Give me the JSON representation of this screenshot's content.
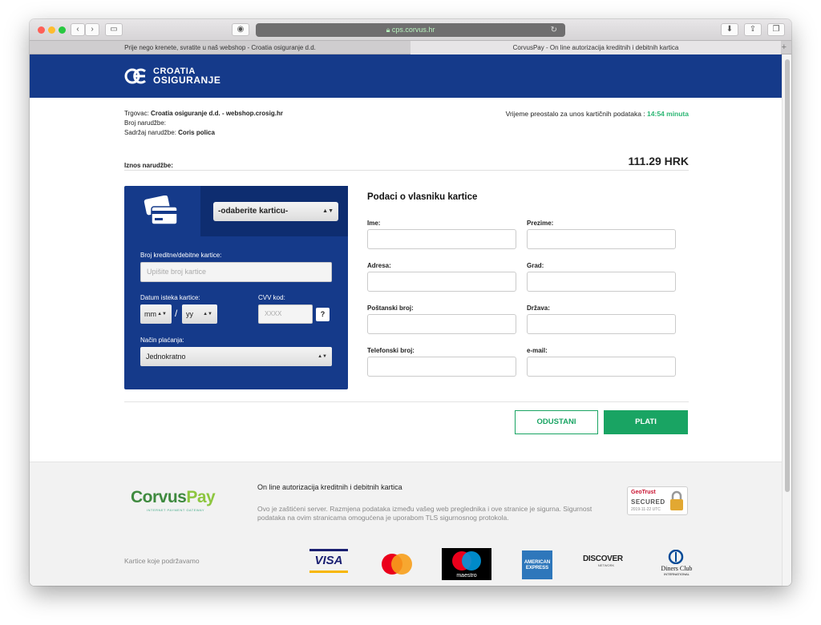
{
  "browser": {
    "url": "cps.corvus.hr",
    "tabs": [
      {
        "label": "Prije nego krenete, svratite u naš webshop - Croatia osiguranje d.d.",
        "active": false
      },
      {
        "label": "CorvusPay - On line autorizacija kreditnih i debitnih kartica",
        "active": true
      }
    ],
    "new_tab": "+"
  },
  "header": {
    "logo_line1": "CROATIA",
    "logo_line2": "OSIGURANJE"
  },
  "order": {
    "merchant_label": "Trgovac: ",
    "merchant_value": "Croatia osiguranje d.d. - webshop.crosig.hr",
    "order_no_label": "Broj narudžbe:",
    "content_label": "Sadržaj narudžbe: ",
    "content_value": "Coris polica",
    "timer_label": "Vrijeme preostalo za unos kartičnih podataka : ",
    "timer_value": "14:54 minuta",
    "amount_label": "Iznos narudžbe:",
    "amount_value": "111.29 HRK"
  },
  "card": {
    "select_label": "-odaberite karticu-",
    "number_label": "Broj kreditne/debitne kartice:",
    "number_placeholder": "Upišite broj kartice",
    "expiry_label": "Datum isteka kartice:",
    "month": "mm",
    "slash": "/",
    "year": "yy",
    "cvv_label": "CVV kod:",
    "cvv_placeholder": "XXXX",
    "help": "?",
    "payment_label": "Način plaćanja:",
    "payment_value": "Jednokratno"
  },
  "owner": {
    "title": "Podaci o vlasniku kartice",
    "fields": {
      "ime": "Ime:",
      "prezime": "Prezime:",
      "adresa": "Adresa:",
      "grad": "Grad:",
      "postanski": "Poštanski broj:",
      "drzava": "Država:",
      "telefon": "Telefonski broj:",
      "email": "e-mail:"
    }
  },
  "actions": {
    "cancel": "ODUSTANI",
    "pay": "PLATI"
  },
  "footer": {
    "brand_a": "Corvus",
    "brand_b": "Pay",
    "brand_sub": "INTERNET PAYMENT GATEWAY",
    "title": "On line autorizacija kreditnih i debitnih kartica",
    "desc": "Ovo je zaštićeni server. Razmjena podataka između vašeg web preglednika i ove stranice je sigurna. Sigurnost podataka na ovim stranicama omogućena je uporabom TLS sigurnosnog protokola.",
    "geotrust_brand": "GeoTrust",
    "geotrust_status": "SECURED",
    "geotrust_date": "2019-11-22 UTC",
    "cards_label": "Kartice koje podržavamo",
    "cards": {
      "visa": "VISA",
      "maestro": "maestro",
      "amex_1": "AMERICAN",
      "amex_2": "EXPRESS",
      "discover": "DISCOVER",
      "discover_sub": "NETWORK",
      "diners_1": "Diners Club",
      "diners_2": "INTERNATIONAL"
    }
  },
  "colors": {
    "brand_blue": "#153a8a",
    "accent_green": "#19a463"
  }
}
